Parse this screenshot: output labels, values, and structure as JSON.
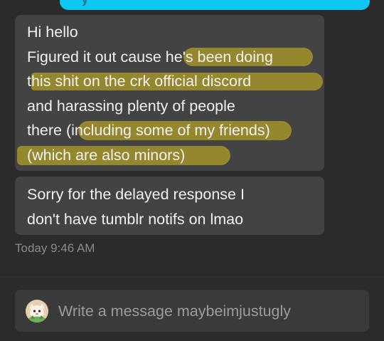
{
  "messages": [
    {
      "lines": [
        "Hi hello",
        "Figured it out cause he's been doing",
        "this shit on the crk official discord",
        "and harassing plenty of people",
        "there (including some of my friends)",
        "(which are also minors)"
      ]
    },
    {
      "lines": [
        "Sorry for the delayed response I",
        "don't have tumblr notifs on lmao"
      ]
    }
  ],
  "timestamp": "Today 9:46 AM",
  "composer": {
    "placeholder": "Write a message maybeimjustugly",
    "value": ""
  },
  "icons": {
    "avatar": "user-avatar-icon"
  },
  "colors": {
    "sent_bubble": "#0ec7f2",
    "received_bubble": "#434343",
    "highlight": "#a69628",
    "background": "#2b2b2b"
  }
}
